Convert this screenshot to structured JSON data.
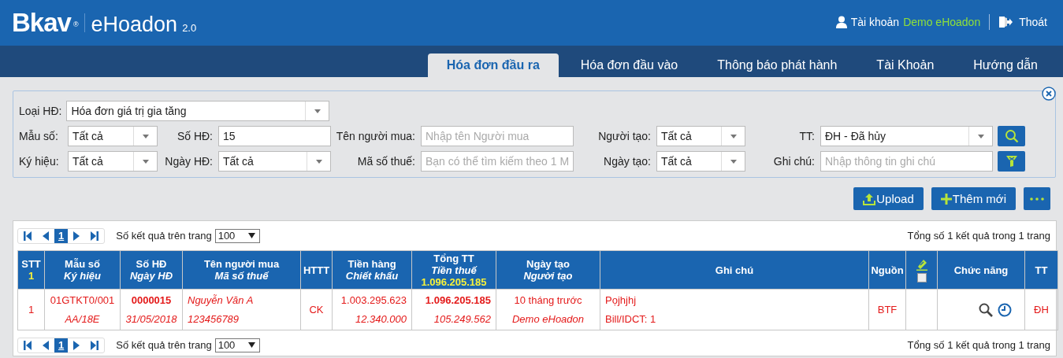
{
  "header": {
    "logo": {
      "brand": "Bkav",
      "registered": "®",
      "product": "eHoadon",
      "version": "2.0"
    },
    "account": {
      "label": "Tài khoản",
      "name": "Demo eHoadon"
    },
    "logout": "Thoát"
  },
  "tabs": [
    {
      "label": "Hóa đơn đầu ra",
      "selected": true
    },
    {
      "label": "Hóa đơn đầu vào",
      "selected": false
    },
    {
      "label": "Thông báo phát hành",
      "selected": false
    },
    {
      "label": "Tài Khoản",
      "selected": false
    },
    {
      "label": "Hướng dẫn",
      "selected": false
    }
  ],
  "filters": {
    "rows": [
      [
        {
          "label": "Loại HĐ:",
          "kind": "select",
          "value": "Hóa đơn giá trị gia tăng"
        }
      ],
      [
        {
          "label": "Mẫu số:",
          "kind": "select",
          "value": "Tất cả"
        },
        {
          "label": "Số HĐ:",
          "kind": "text",
          "value": "15"
        },
        {
          "label": "Tên người mua:",
          "kind": "text",
          "placeholder": "Nhập tên Người mua"
        },
        {
          "label": "Người tạo:",
          "kind": "select",
          "value": "Tất cả"
        },
        {
          "label": "TT:",
          "kind": "select",
          "value": "ĐH - Đã hủy"
        },
        {
          "kind": "search_button"
        }
      ],
      [
        {
          "label": "Ký hiệu:",
          "kind": "select",
          "value": "Tất cả"
        },
        {
          "label": "Ngày HĐ:",
          "kind": "select",
          "value": "Tất cả"
        },
        {
          "label": "Mã số thuế:",
          "kind": "text",
          "placeholder": "Bạn có thể tìm kiếm theo 1 M"
        },
        {
          "label": "Ngày tạo:",
          "kind": "select",
          "value": "Tất cả"
        },
        {
          "label": "Ghi chú:",
          "kind": "text",
          "placeholder": "Nhập thông tin ghi chú"
        },
        {
          "kind": "clear_filter_button"
        }
      ]
    ]
  },
  "actions": [
    {
      "kind": "upload",
      "label": "Upload"
    },
    {
      "kind": "add",
      "label": "Thêm mới"
    },
    {
      "kind": "more"
    }
  ],
  "pagers": [
    {
      "page": "1",
      "per_page_label": "Số kết quả trên trang",
      "per_page": "100",
      "summary": "Tổng số 1 kết quả trong 1 trang"
    },
    {
      "page": "1",
      "per_page_label": "Số kết quả trên trang",
      "per_page": "100",
      "summary": "Tổng số 1 kết quả trong 1 trang"
    }
  ],
  "table": {
    "columns": [
      {
        "title": "STT",
        "total": "1"
      },
      {
        "title": "Mẫu số",
        "subtitle": "Ký hiệu"
      },
      {
        "title": "Số HĐ",
        "subtitle": "Ngày HĐ"
      },
      {
        "title": "Tên người mua",
        "subtitle": "Mã số thuế"
      },
      {
        "title": "HTTT"
      },
      {
        "title": "Tiền hàng",
        "subtitle": "Chiết khấu"
      },
      {
        "title": "Tổng TT",
        "subtitle": "Tiền thuế",
        "total": "1.096.205.185"
      },
      {
        "title": "Ngày tạo",
        "subtitle": "Người tạo"
      },
      {
        "title": "Ghi chú"
      },
      {
        "title": "Nguồn"
      },
      {
        "kind": "sign_select",
        "checked": false
      },
      {
        "title": "Chức năng"
      },
      {
        "title": "TT"
      }
    ],
    "rows": [
      {
        "cells": [
          {
            "lines": [
              "1"
            ]
          },
          {
            "lines": [
              "01GTKT0/001",
              "AA/18E"
            ]
          },
          {
            "lines": [
              "0000015",
              "31/05/2018"
            ]
          },
          {
            "lines": [
              "Nguyễn Văn A",
              "123456789"
            ]
          },
          {
            "lines": [
              "CK"
            ]
          },
          {
            "lines": [
              "1.003.295.623",
              "12.340.000"
            ]
          },
          {
            "lines": [
              "1.096.205.185",
              "105.249.562"
            ]
          },
          {
            "lines": [
              "10 tháng trước",
              "Demo eHoadon"
            ]
          },
          {
            "lines": [
              "Pọjhjhj",
              "Bill/IDCT: 1"
            ]
          },
          {
            "lines": [
              "BTF"
            ]
          },
          {},
          {
            "kind": "actions",
            "buttons": [
              {
                "kind": "view"
              },
              {
                "kind": "history"
              }
            ]
          },
          {
            "lines": [
              "ĐH"
            ]
          }
        ]
      }
    ]
  }
}
